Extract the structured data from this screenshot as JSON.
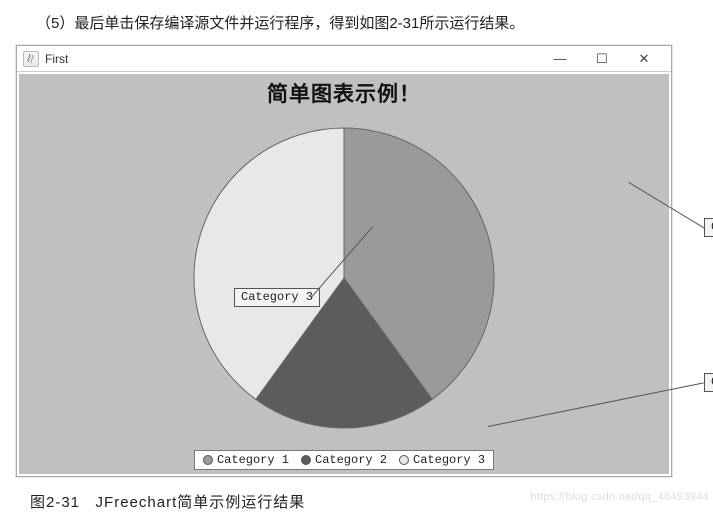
{
  "doc_text": {
    "top": "（5）最后单击保存编译源文件并运行程序，得到如图2-31所示运行结果。",
    "bottom_label": "图2-31",
    "bottom_desc": "JFreechart简单示例运行结果"
  },
  "window": {
    "title": "First",
    "buttons": {
      "minimize": "—",
      "maximize": "☐",
      "close": "✕"
    }
  },
  "watermark": "https://blog.csdn.net/qq_40493944",
  "chart_data": {
    "type": "pie",
    "title": "简单图表示例！",
    "series": [
      {
        "name": "Category 1",
        "value": 40,
        "color": "#9a9a9a"
      },
      {
        "name": "Category 2",
        "value": 20,
        "color": "#5c5c5c"
      },
      {
        "name": "Category 3",
        "value": 40,
        "color": "#e8e8e8"
      }
    ],
    "legend_position": "bottom"
  }
}
